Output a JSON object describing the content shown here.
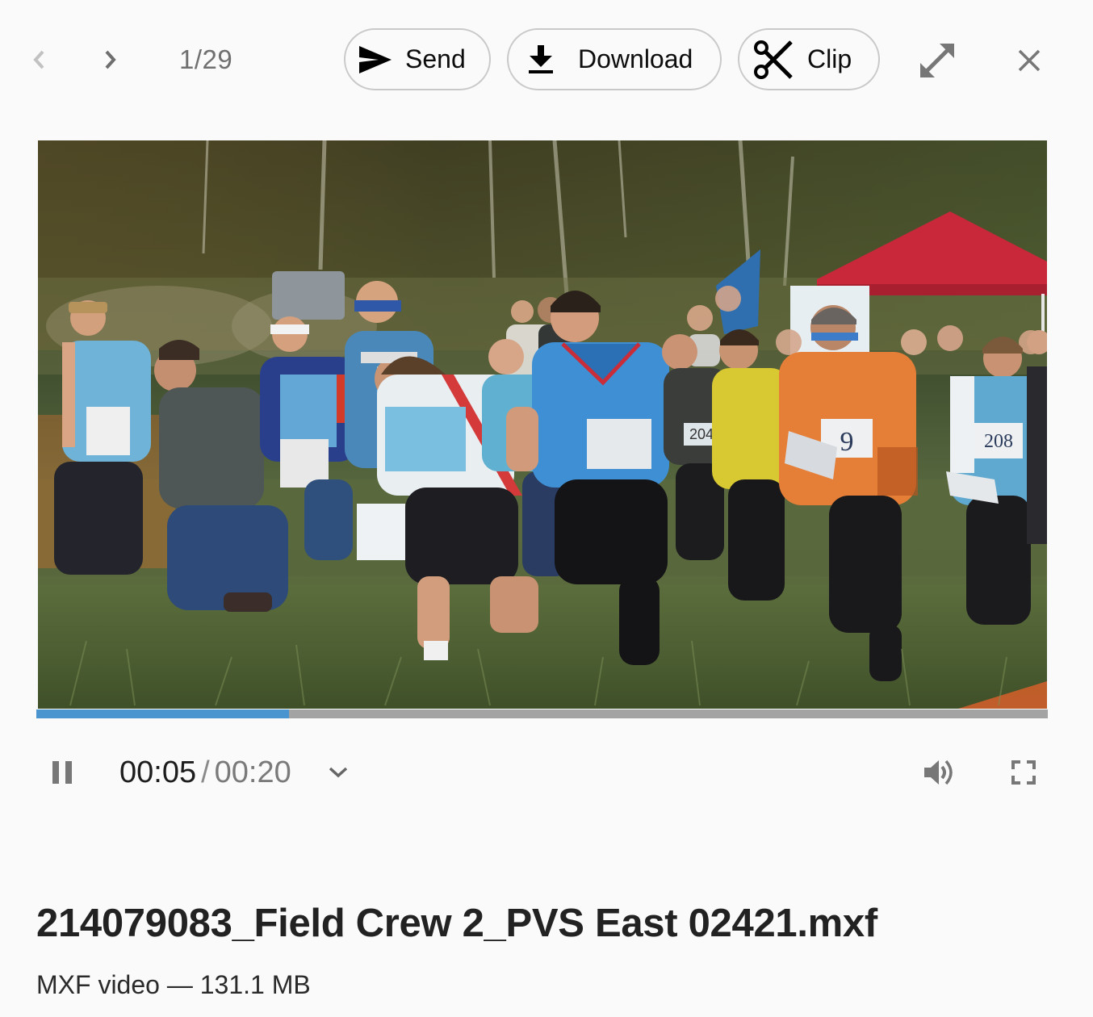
{
  "toolbar": {
    "prev_icon": "chevron-left-icon",
    "next_icon": "chevron-right-icon",
    "counter": "1/29",
    "send_label": "Send",
    "send_icon": "send-icon",
    "download_label": "Download",
    "download_icon": "download-icon",
    "clip_label": "Clip",
    "clip_icon": "scissors-icon",
    "expand_icon": "expand-diagonal-icon",
    "close_icon": "close-icon"
  },
  "player": {
    "current_time": "00:05",
    "separator": "/",
    "duration": "00:20",
    "progress_fraction": 0.25,
    "state": "playing",
    "pause_icon": "pause-icon",
    "speed_menu_icon": "chevron-down-icon",
    "volume_icon": "volume-icon",
    "fullscreen_icon": "fullscreen-icon",
    "colors": {
      "progress_fill": "#4a94d0",
      "progress_track": "#a3a3a3"
    },
    "frame": {
      "description": "Orienteering race mass start: runners with bibs and maps sprinting across grass in front of a forest and a red tent",
      "bib_numbers": [
        "9",
        "208",
        "204"
      ]
    }
  },
  "file": {
    "name": "214079083_Field Crew 2_PVS East 02421.mxf",
    "type_label": "MXF video",
    "dash": "—",
    "size": "131.1 MB"
  }
}
